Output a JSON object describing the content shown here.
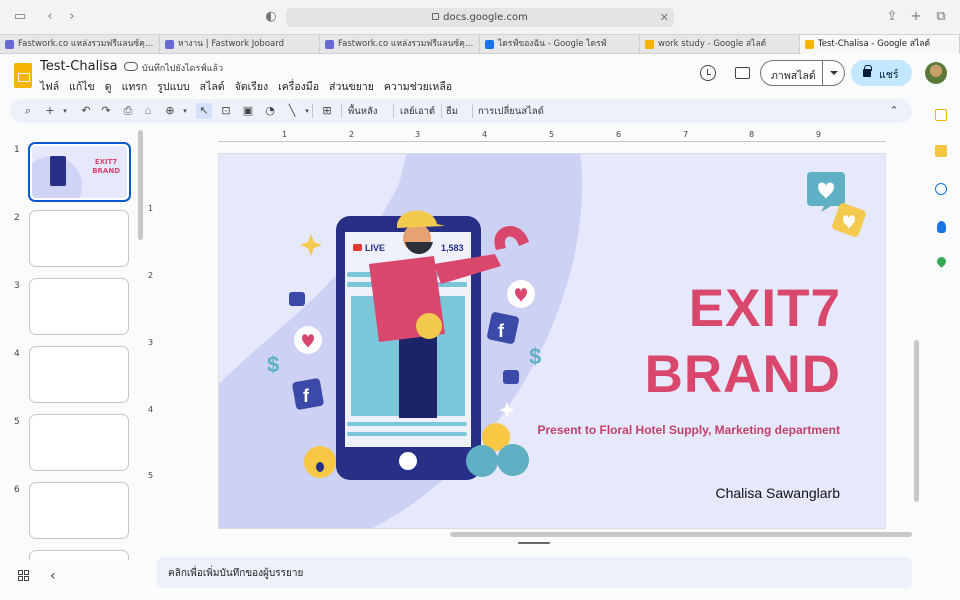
{
  "browser": {
    "url": "docs.google.com",
    "tabs": [
      {
        "label": "Fastwork.co แหล่งรวมฟรีแลนซ์คุณภา...",
        "color": "#6b6bd6"
      },
      {
        "label": "หางาน | Fastwork Joboard",
        "color": "#6b6bd6"
      },
      {
        "label": "Fastwork.co แหล่งรวมฟรีแลนซ์คุณภา...",
        "color": "#6b6bd6"
      },
      {
        "label": "ไดรฟ์ของฉัน - Google ไดรฟ์",
        "color": "#1a73e8"
      },
      {
        "label": "work study - Google สไลด์",
        "color": "#f4b400"
      },
      {
        "label": "Test-Chalisa - Google สไลด์",
        "color": "#f4b400"
      }
    ]
  },
  "doc": {
    "title": "Test-Chalisa",
    "save_status": "บันทึกไปยังไดรฟ์แล้ว",
    "menus": [
      "ไฟล์",
      "แก้ไข",
      "ดู",
      "แทรก",
      "รูปแบบ",
      "สไลด์",
      "จัดเรียง",
      "เครื่องมือ",
      "ส่วนขยาย",
      "ความช่วยเหลือ"
    ],
    "present_label": "ภาพสไลด์",
    "share_label": "แชร์"
  },
  "toolbar": {
    "background": "พื้นหลัง",
    "layout": "เลย์เอาต์",
    "theme": "ธีม",
    "transition": "การเปลี่ยนสไลด์"
  },
  "filmstrip": {
    "numbers": [
      "1",
      "2",
      "3",
      "4",
      "5",
      "6"
    ],
    "thumb1_title_1": "EXIT7",
    "thumb1_title_2": "BRAND"
  },
  "ruler": {
    "h": [
      "1",
      "2",
      "3",
      "4",
      "5",
      "6",
      "7",
      "8",
      "9"
    ],
    "v": [
      "1",
      "2",
      "3",
      "4",
      "5"
    ]
  },
  "slide": {
    "title_line1": "EXIT7",
    "title_line2": "BRAND",
    "subtitle": "Present to Floral Hotel Supply, Marketing department",
    "author": "Chalisa Sawanglarb",
    "live_label": "LIVE",
    "viewer_count": "1,583",
    "colors": {
      "title": "#d9476d",
      "background": "#e6e8fb",
      "phone": "#272f86",
      "arc": "#cdd1f3"
    }
  },
  "notes": {
    "placeholder": "คลิกเพื่อเพิ่มบันทึกของผู้บรรยาย"
  }
}
